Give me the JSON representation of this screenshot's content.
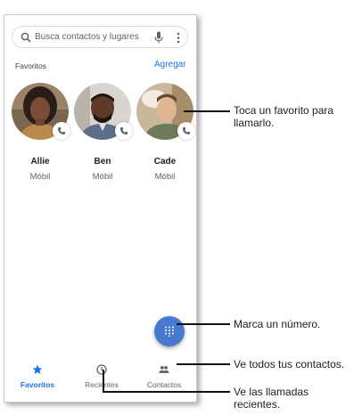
{
  "search": {
    "placeholder": "Busca contactos y lugares"
  },
  "favorites_section": {
    "title": "Favoritos",
    "add_label": "Agregar"
  },
  "contacts": [
    {
      "name": "Allie",
      "type": "Móbil"
    },
    {
      "name": "Ben",
      "type": "Móbil"
    },
    {
      "name": "Cade",
      "type": "Móbil"
    }
  ],
  "bottom_nav": {
    "items": [
      {
        "label": "Favoritos",
        "icon": "star-icon",
        "active": true
      },
      {
        "label": "Recientes",
        "icon": "clock-icon",
        "active": false
      },
      {
        "label": "Contactos",
        "icon": "people-icon",
        "active": false
      }
    ]
  },
  "annotations": {
    "favorite": "Toca un favorito para llamarlo.",
    "dial": "Marca un número.",
    "contacts": "Ve todos tus contactos.",
    "recents": "Ve las llamadas recientes."
  },
  "colors": {
    "accent": "#1a73e8",
    "fab": "#4679cf"
  }
}
